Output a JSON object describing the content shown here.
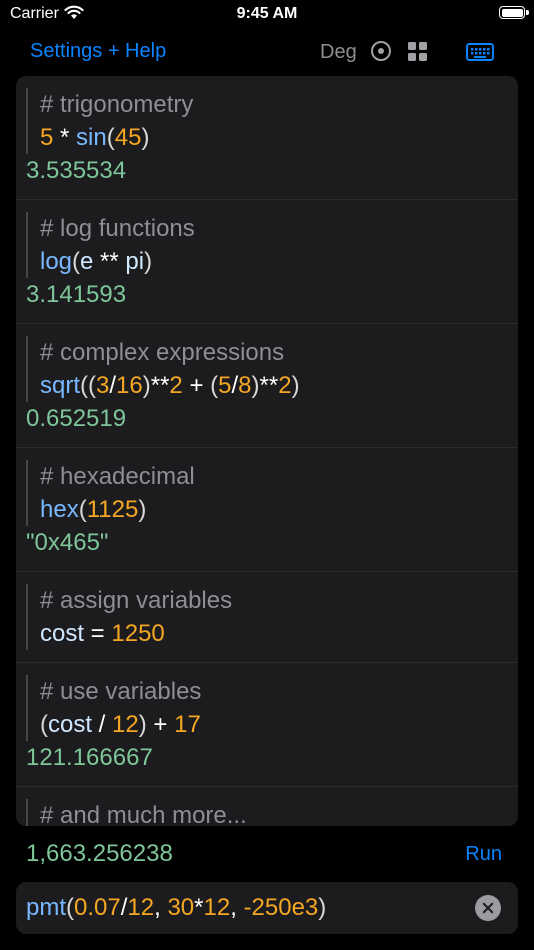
{
  "status_bar": {
    "carrier": "Carrier",
    "time": "9:45 AM"
  },
  "toolbar": {
    "settings_label": "Settings + Help",
    "angle_mode": "Deg",
    "radio_icon": "radio-circle-icon",
    "grid_icon": "grid-icon",
    "keyboard_icon": "keyboard-icon"
  },
  "entries": [
    {
      "comment": "# trigonometry",
      "expr": [
        {
          "t": "5",
          "k": "num"
        },
        {
          "t": " * ",
          "k": "op"
        },
        {
          "t": "sin",
          "k": "fn"
        },
        {
          "t": "(",
          "k": "paren"
        },
        {
          "t": "45",
          "k": "num"
        },
        {
          "t": ")",
          "k": "paren"
        }
      ],
      "result": "3.535534"
    },
    {
      "comment": "# log functions",
      "expr": [
        {
          "t": "log",
          "k": "fn"
        },
        {
          "t": "(",
          "k": "paren"
        },
        {
          "t": "e",
          "k": "var"
        },
        {
          "t": " ** ",
          "k": "op"
        },
        {
          "t": "pi",
          "k": "var"
        },
        {
          "t": ")",
          "k": "paren"
        }
      ],
      "result": "3.141593"
    },
    {
      "comment": "# complex expressions",
      "expr": [
        {
          "t": "sqrt",
          "k": "fn"
        },
        {
          "t": "((",
          "k": "paren"
        },
        {
          "t": "3",
          "k": "num"
        },
        {
          "t": "/",
          "k": "op"
        },
        {
          "t": "16",
          "k": "num"
        },
        {
          "t": ")",
          "k": "paren"
        },
        {
          "t": "**",
          "k": "op"
        },
        {
          "t": "2",
          "k": "num"
        },
        {
          "t": " + ",
          "k": "op"
        },
        {
          "t": "(",
          "k": "paren"
        },
        {
          "t": "5",
          "k": "num"
        },
        {
          "t": "/",
          "k": "op"
        },
        {
          "t": "8",
          "k": "num"
        },
        {
          "t": ")",
          "k": "paren"
        },
        {
          "t": "**",
          "k": "op"
        },
        {
          "t": "2",
          "k": "num"
        },
        {
          "t": ")",
          "k": "paren"
        }
      ],
      "result": "0.652519"
    },
    {
      "comment": "# hexadecimal",
      "expr": [
        {
          "t": "hex",
          "k": "fn"
        },
        {
          "t": "(",
          "k": "paren"
        },
        {
          "t": "1125",
          "k": "num"
        },
        {
          "t": ")",
          "k": "paren"
        }
      ],
      "result": "\"0x465\""
    },
    {
      "comment": "# assign variables",
      "expr": [
        {
          "t": "cost",
          "k": "var"
        },
        {
          "t": " = ",
          "k": "op"
        },
        {
          "t": "1250",
          "k": "num"
        }
      ],
      "result": ""
    },
    {
      "comment": "# use variables",
      "expr": [
        {
          "t": "(",
          "k": "paren"
        },
        {
          "t": "cost",
          "k": "var"
        },
        {
          "t": " / ",
          "k": "op"
        },
        {
          "t": "12",
          "k": "num"
        },
        {
          "t": ")",
          "k": "paren"
        },
        {
          "t": " + ",
          "k": "op"
        },
        {
          "t": "17",
          "k": "num"
        }
      ],
      "result": "121.166667"
    },
    {
      "comment": "# and much more...",
      "expr": [],
      "result": ""
    }
  ],
  "total": "1,663.256238",
  "run_label": "Run",
  "input": {
    "tokens": [
      {
        "t": "pmt",
        "k": "fn"
      },
      {
        "t": "(",
        "k": "paren"
      },
      {
        "t": "0.07",
        "k": "num"
      },
      {
        "t": "/",
        "k": "op"
      },
      {
        "t": "12",
        "k": "num"
      },
      {
        "t": ", ",
        "k": "op"
      },
      {
        "t": "30",
        "k": "num"
      },
      {
        "t": "*",
        "k": "op"
      },
      {
        "t": "12",
        "k": "num"
      },
      {
        "t": ", ",
        "k": "op"
      },
      {
        "t": "-250e3",
        "k": "num"
      },
      {
        "t": ")",
        "k": "paren"
      }
    ],
    "clear_icon": "clear-circle-icon"
  },
  "colors": {
    "accent": "#0a84ff",
    "result": "#7ec699",
    "number": "#f5a623",
    "function": "#79b8ff",
    "comment": "#8e8e93"
  }
}
